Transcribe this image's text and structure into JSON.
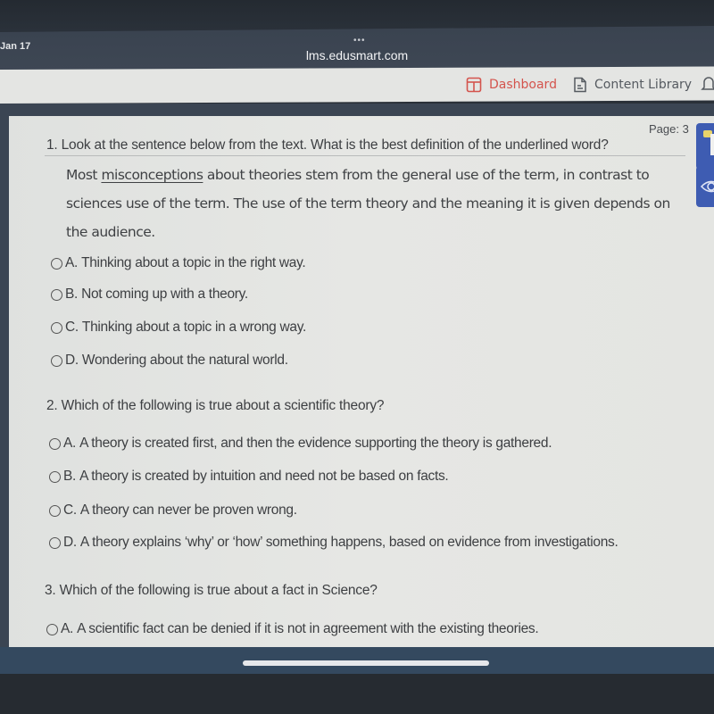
{
  "status_bar": {
    "time": "Jan 17",
    "more_dots": "•••"
  },
  "browser": {
    "url": "lms.edusmart.com"
  },
  "header": {
    "nav": [
      {
        "label": "Dashboard",
        "icon": "dashboard-icon",
        "active": true,
        "color": "#d4544d"
      },
      {
        "label": "Content Library",
        "icon": "document-icon",
        "active": false
      }
    ],
    "bell_icon": "bell-icon"
  },
  "page": {
    "label": "Page: 3"
  },
  "side_tools": [
    {
      "icon": "text-to-speech-icon"
    },
    {
      "icon": "eye-icon"
    }
  ],
  "questions": [
    {
      "number": "1.",
      "text": "Look at the sentence below from the text. What is the best definition of the underlined word?",
      "passage": {
        "before": "Most ",
        "underlined": "misconceptions",
        "after": " about theories stem from the general use of the term, in contrast to sciences use of the term. The use of the term theory and the meaning it is given depends on the audience."
      },
      "options": [
        {
          "label": "A.",
          "text": "Thinking about a topic in the right way."
        },
        {
          "label": "B.",
          "text": "Not coming up with a theory."
        },
        {
          "label": "C.",
          "text": "Thinking about a topic in a wrong way."
        },
        {
          "label": "D.",
          "text": "Wondering about the natural world."
        }
      ]
    },
    {
      "number": "2.",
      "text": "Which of the following is true about a scientific theory?",
      "options": [
        {
          "label": "A.",
          "text": "A theory is created first, and then the evidence supporting the theory is gathered."
        },
        {
          "label": "B.",
          "text": "A theory is created by intuition and need not be based on facts."
        },
        {
          "label": "C.",
          "text": "A theory can never be proven wrong."
        },
        {
          "label": "D.",
          "text": "A theory explains ‘why’ or ‘how’ something happens, based on evidence from investigations."
        }
      ]
    },
    {
      "number": "3.",
      "text": "Which of the following is true about a fact in Science?",
      "options": [
        {
          "label": "A.",
          "text": "A scientific fact can be denied if it is not in agreement with the existing theories."
        }
      ]
    }
  ]
}
